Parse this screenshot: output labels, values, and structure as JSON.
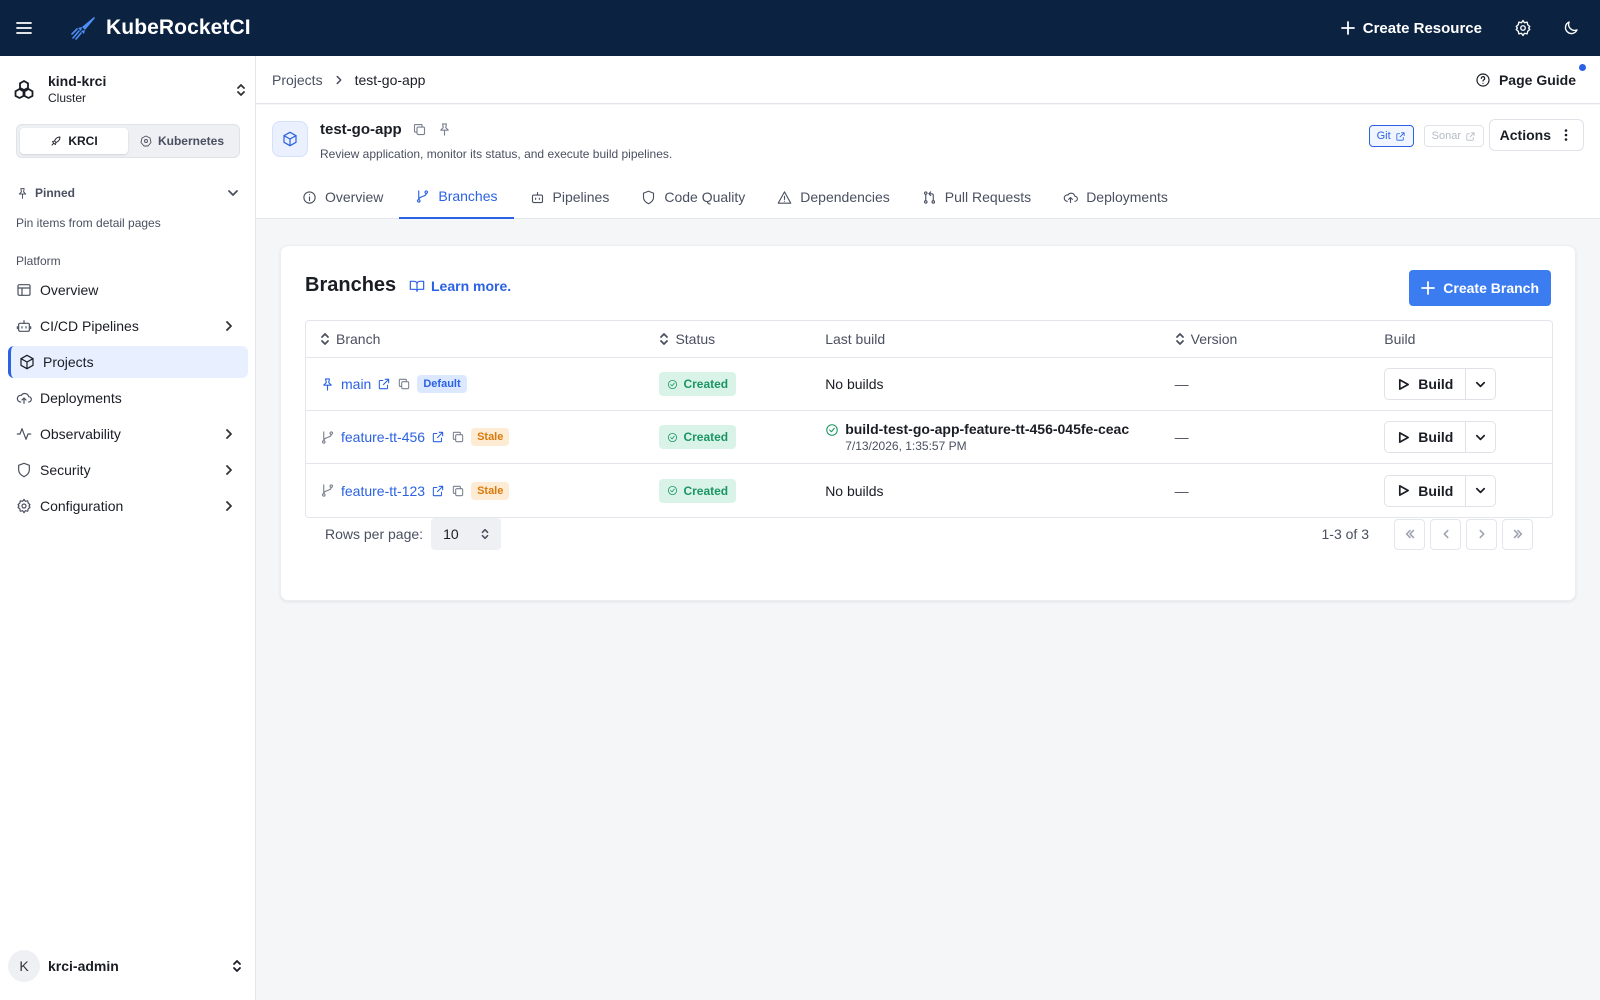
{
  "app": {
    "name": "KubeRocketCI",
    "create_resource": "Create Resource"
  },
  "cluster": {
    "name": "kind-krci",
    "type": "Cluster"
  },
  "mode_switch": [
    {
      "label": "KRCI",
      "active": true
    },
    {
      "label": "Kubernetes",
      "active": false
    }
  ],
  "pinned": {
    "label": "Pinned",
    "empty_note": "Pin items from detail pages"
  },
  "nav": {
    "section": "Platform",
    "items": [
      {
        "label": "Overview",
        "icon": "table-icon",
        "expandable": false,
        "active": false
      },
      {
        "label": "CI/CD Pipelines",
        "icon": "robot-icon",
        "expandable": true,
        "active": false
      },
      {
        "label": "Projects",
        "icon": "cube-icon",
        "expandable": false,
        "active": true
      },
      {
        "label": "Deployments",
        "icon": "cloud-upload-icon",
        "expandable": false,
        "active": false
      },
      {
        "label": "Observability",
        "icon": "activity-icon",
        "expandable": true,
        "active": false
      },
      {
        "label": "Security",
        "icon": "shield-icon",
        "expandable": true,
        "active": false
      },
      {
        "label": "Configuration",
        "icon": "gear-icon",
        "expandable": true,
        "active": false
      }
    ]
  },
  "user": {
    "initial": "K",
    "name": "krci-admin"
  },
  "breadcrumb": {
    "parent": "Projects",
    "current": "test-go-app"
  },
  "page_guide": "Page Guide",
  "project": {
    "name": "test-go-app",
    "description": "Review application, monitor its status, and execute build pipelines.",
    "links": {
      "git": "Git",
      "sonar": "Sonar"
    },
    "actions": "Actions"
  },
  "tabs": [
    {
      "label": "Overview",
      "icon": "info-icon",
      "active": false
    },
    {
      "label": "Branches",
      "icon": "git-branch-icon",
      "active": true
    },
    {
      "label": "Pipelines",
      "icon": "robot-icon",
      "active": false
    },
    {
      "label": "Code Quality",
      "icon": "shield-icon",
      "active": false
    },
    {
      "label": "Dependencies",
      "icon": "warning-icon",
      "active": false
    },
    {
      "label": "Pull Requests",
      "icon": "git-pull-request-icon",
      "active": false
    },
    {
      "label": "Deployments",
      "icon": "cloud-upload-icon",
      "active": false
    }
  ],
  "branches": {
    "title": "Branches",
    "learn_more": "Learn more.",
    "create_button": "Create Branch",
    "columns": {
      "branch": "Branch",
      "status": "Status",
      "last_build": "Last build",
      "version": "Version",
      "build": "Build"
    },
    "rows": [
      {
        "name": "main",
        "tag": "Default",
        "status": "Created",
        "last_build": "No builds",
        "build_time": "",
        "version": "—",
        "build_label": "Build"
      },
      {
        "name": "feature-tt-456",
        "tag": "Stale",
        "status": "Created",
        "last_build": "build-test-go-app-feature-tt-456-045fe-ceac",
        "build_time": "7/13/2026, 1:35:57 PM",
        "version": "—",
        "build_label": "Build"
      },
      {
        "name": "feature-tt-123",
        "tag": "Stale",
        "status": "Created",
        "last_build": "No builds",
        "build_time": "",
        "version": "—",
        "build_label": "Build"
      }
    ],
    "pagination": {
      "rows_per_page_label": "Rows per page:",
      "rows_per_page": "10",
      "range": "1-3 of 3"
    }
  },
  "colors": {
    "topbar": "#0b2241",
    "accent": "#2b62e3",
    "success": "#1a9663",
    "warning": "#d97a0c"
  }
}
